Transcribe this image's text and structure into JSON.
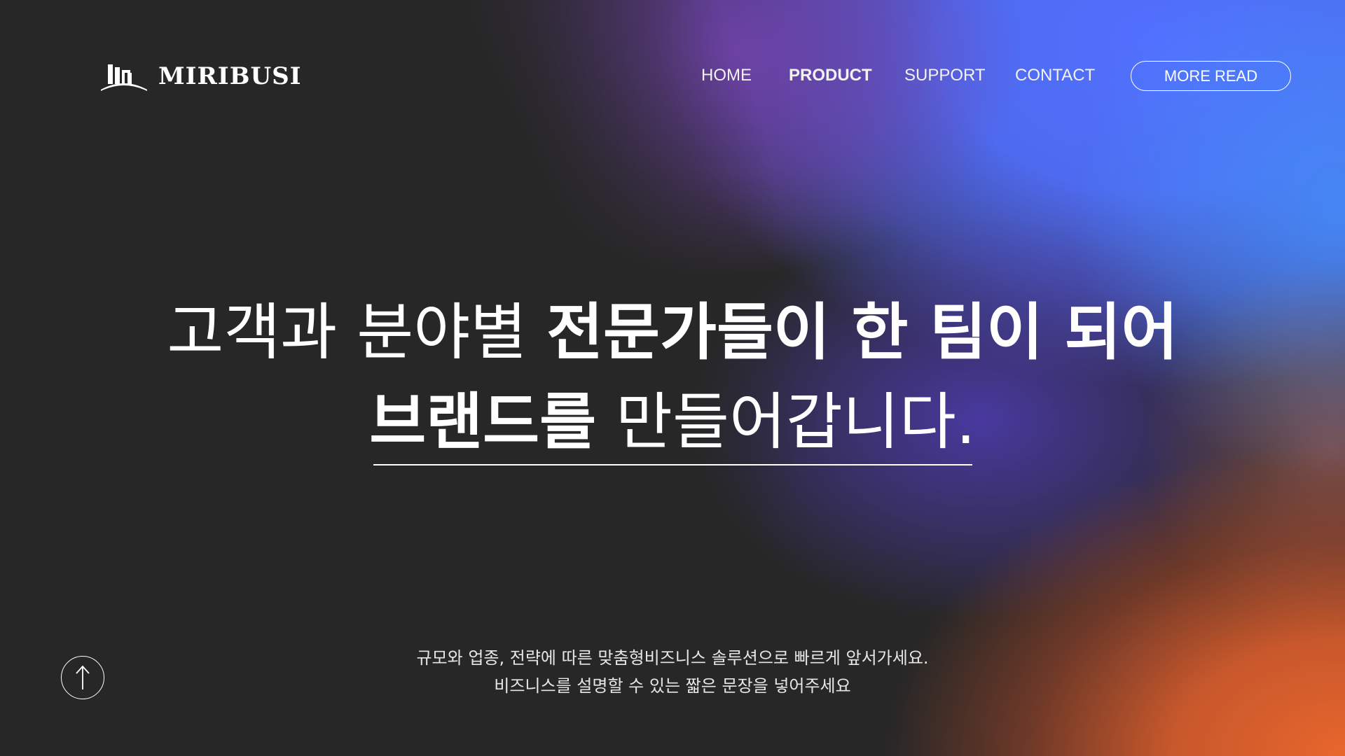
{
  "header": {
    "logo_text": "MIRIBUSI",
    "logo_icon": "building-logo-icon",
    "nav": [
      {
        "label": "HOME",
        "active": false
      },
      {
        "label": "PRODUCT",
        "active": true
      },
      {
        "label": "SUPPORT",
        "active": false
      },
      {
        "label": "CONTACT",
        "active": false
      }
    ],
    "cta_label": "MORE READ"
  },
  "hero": {
    "line1_light": "고객과 분야별 ",
    "line1_bold": "전문가들이 한 팀이 되어",
    "line2_bold": "브랜드를",
    "line2_light": " 만들어갑니다."
  },
  "subtext": {
    "line1": "규모와 업종, 전략에 따른 맞춤형비즈니스 솔루션으로 빠르게 앞서가세요.",
    "line2": "비즈니스를 설명할 수 있는 짧은 문장을 넣어주세요"
  },
  "scroll_top": {
    "icon": "arrow-up-icon"
  },
  "colors": {
    "background": "#272727",
    "gradient_blue": "#5270FF",
    "gradient_purple": "#7042AA",
    "gradient_orange": "#E8662C",
    "text": "#FFFFFF"
  }
}
